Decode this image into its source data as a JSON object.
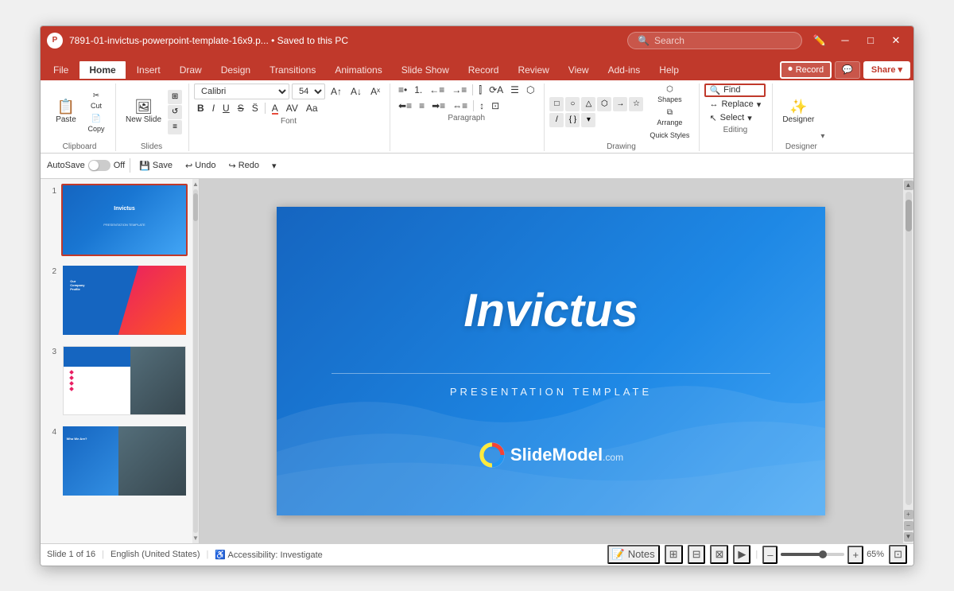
{
  "window": {
    "title": "7891-01-invictus-powerpoint-template-16x9.p... • Saved to this PC",
    "search_placeholder": "Search"
  },
  "tabs": {
    "items": [
      "File",
      "Home",
      "Insert",
      "Draw",
      "Design",
      "Transitions",
      "Animations",
      "Slide Show",
      "Record",
      "Review",
      "View",
      "Add-ins",
      "Help"
    ],
    "active": "Home"
  },
  "ribbon_right": {
    "record_label": "Record",
    "share_label": "Share"
  },
  "quick_access": {
    "autosave_label": "AutoSave",
    "autosave_state": "Off",
    "save_label": "Save",
    "undo_label": "Undo",
    "redo_label": "Redo"
  },
  "ribbon_groups": {
    "clipboard": {
      "label": "Clipboard",
      "paste_label": "Paste",
      "cut_label": "Cut",
      "copy_label": "Copy"
    },
    "slides": {
      "label": "Slides",
      "new_slide_label": "New Slide"
    },
    "font": {
      "label": "Font",
      "font_name": "Calibri",
      "font_size": "54",
      "bold": "B",
      "italic": "I",
      "underline": "U",
      "strikethrough": "S"
    },
    "paragraph": {
      "label": "Paragraph"
    },
    "drawing": {
      "label": "Drawing",
      "shapes_label": "Shapes",
      "arrange_label": "Arrange",
      "quick_styles_label": "Quick Styles"
    },
    "editing": {
      "label": "Editing",
      "find_label": "Find",
      "replace_label": "Replace",
      "select_label": "Select"
    },
    "designer": {
      "label": "Designer",
      "designer_label": "Designer"
    }
  },
  "slides": [
    {
      "num": "1",
      "active": true
    },
    {
      "num": "2",
      "active": false
    },
    {
      "num": "3",
      "active": false
    },
    {
      "num": "4",
      "active": false
    }
  ],
  "canvas": {
    "title": "Invictus",
    "subtitle": "PRESENTATION TEMPLATE",
    "logo_text": "SlideModel",
    "logo_suffix": ".com"
  },
  "status_bar": {
    "slide_info": "Slide 1 of 16",
    "language": "English (United States)",
    "accessibility": "Accessibility: Investigate",
    "notes_label": "Notes",
    "zoom_level": "65%"
  }
}
